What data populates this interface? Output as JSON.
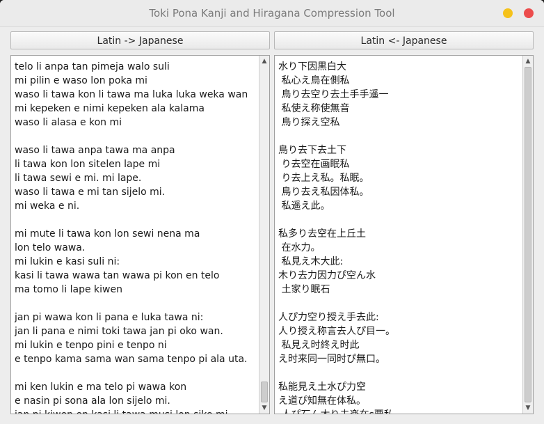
{
  "window": {
    "title": "Toki Pona Kanji and Hiragana Compression Tool"
  },
  "toolbar": {
    "to_japanese_label": "Latin -> Japanese",
    "to_latin_label": "Latin <- Japanese"
  },
  "latin_text": [
    "telo li anpa tan pimeja walo suli",
    "mi pilin e waso lon poka mi",
    "waso li tawa kon li tawa ma luka luka weka wan",
    "mi kepeken e nimi kepeken ala kalama",
    "waso li alasa e kon mi",
    "",
    "waso li tawa anpa tawa ma anpa",
    "li tawa kon lon sitelen lape mi",
    "li tawa sewi e mi. mi lape.",
    "waso li tawa e mi tan sijelo mi.",
    "mi weka e ni.",
    "",
    "mi mute li tawa kon lon sewi nena ma",
    "lon telo wawa.",
    "mi lukin e kasi suli ni:",
    "kasi li tawa wawa tan wawa pi kon en telo",
    "ma tomo li lape kiwen",
    "",
    "jan pi wawa kon li pana e luka tawa ni:",
    "jan li pana e nimi toki tawa jan pi oko wan.",
    "mi lukin e tenpo pini e tenpo ni",
    "e tenpo kama sama wan sama tenpo pi ala uta.",
    "",
    "mi ken lukin e ma telo pi wawa kon",
    "e nasin pi sona ala lon sijelo mi.",
    "jan pi kiwen en kasi li tawa musi lon sike mi."
  ],
  "japanese_text": [
    "水り下因黒白大",
    " 私心え鳥在側私",
    " 鳥り去空り去土手手遥一",
    " 私使え称使無音",
    " 鳥り探え空私",
    "",
    "鳥り去下去土下",
    " り去空在画眠私",
    " り去上え私。私眠。",
    " 鳥り去え私因体私。",
    " 私遥え此。",
    "",
    "私多り去空在上丘土",
    " 在水力。",
    " 私見え木大此:",
    "木り去力因力ぴ空ん水",
    " 土家り眠石",
    "",
    "人ぴ力空り授え手去此:",
    "人り授え称言去人ぴ目一。",
    " 私見え时終え时此",
    "え时来同一同时ぴ無口。",
    "",
    "私能見え土水ぴ力空",
    "え道ぴ知無在体私。",
    " 人ぴ石ん木り去楽在s要私"
  ],
  "icons": {
    "minimize": "minimize-icon",
    "close": "close-icon",
    "scroll_up": "scroll-up-arrow-icon",
    "scroll_down": "scroll-down-arrow-icon"
  },
  "colors": {
    "minimize": "#f5c21b",
    "close": "#ec4c4c",
    "title_text": "#7b7b7b"
  }
}
